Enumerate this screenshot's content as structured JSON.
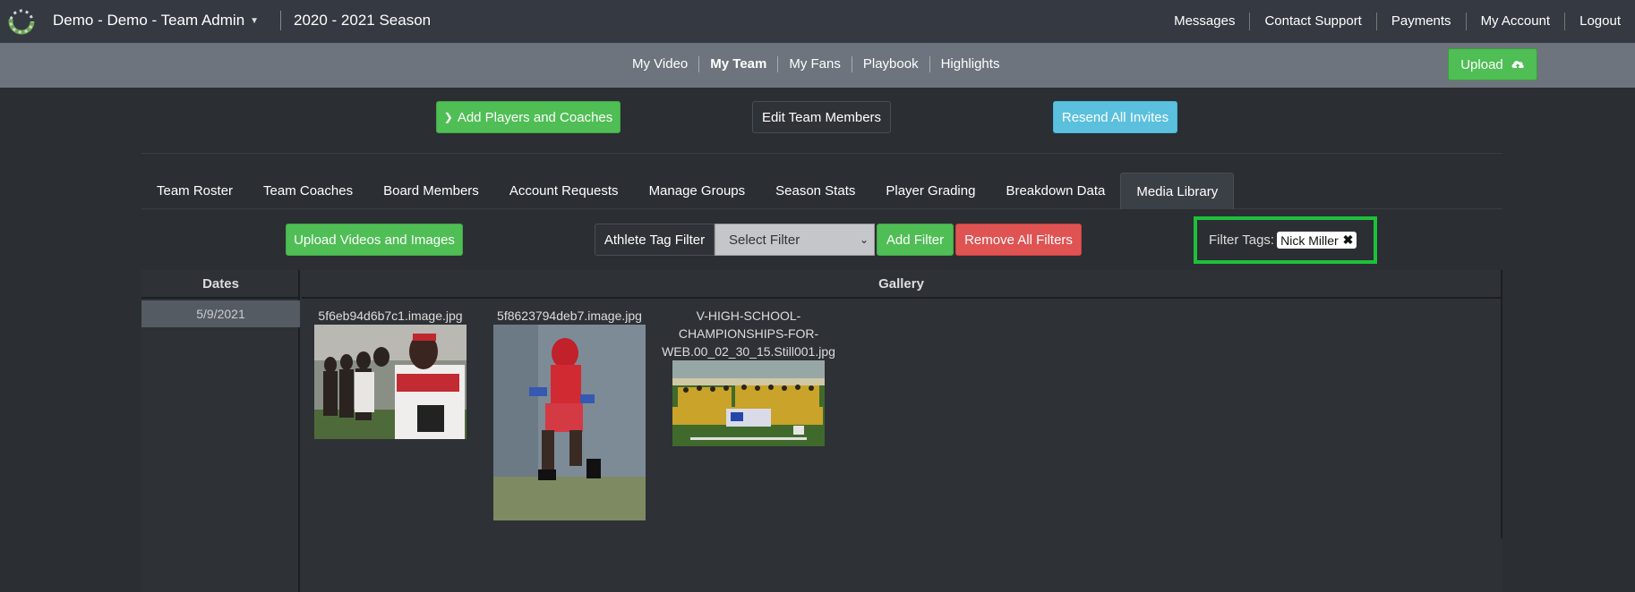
{
  "topbar": {
    "team_name": "Demo - Demo - Team Admin",
    "season": "2020 - 2021 Season",
    "links": [
      "Messages",
      "Contact Support",
      "Payments",
      "My Account",
      "Logout"
    ]
  },
  "subnav": {
    "links": [
      "My Video",
      "My Team",
      "My Fans",
      "Playbook",
      "Highlights"
    ],
    "active": "My Team",
    "upload_label": "Upload"
  },
  "actions": {
    "add_players": "Add Players and Coaches",
    "edit_members": "Edit Team Members",
    "resend_invites": "Resend All Invites"
  },
  "tabs": [
    "Team Roster",
    "Team Coaches",
    "Board Members",
    "Account Requests",
    "Manage Groups",
    "Season Stats",
    "Player Grading",
    "Breakdown Data",
    "Media Library"
  ],
  "active_tab": "Media Library",
  "filters": {
    "upload_media": "Upload Videos and Images",
    "athlete_tag_filter": "Athlete Tag Filter",
    "select_value": "Select Filter",
    "add_filter": "Add Filter",
    "remove_all": "Remove All Filters",
    "filter_tags_label": "Filter Tags:",
    "tags": [
      "Nick Miller"
    ]
  },
  "table": {
    "dates_header": "Dates",
    "gallery_header": "Gallery",
    "dates": [
      "5/9/2021"
    ],
    "gallery": [
      {
        "name": "5f6eb94d6b7c1.image.jpg"
      },
      {
        "name": "5f8623794deb7.image.jpg"
      },
      {
        "name": "V-HIGH-SCHOOL-CHAMPIONSHIPS-FOR-WEB.00_02_30_15.Still001.jpg",
        "lines": [
          "V-HIGH-SCHOOL-",
          "CHAMPIONSHIPS-FOR-",
          "WEB.00_02_30_15.Still001.jpg"
        ]
      }
    ]
  },
  "colors": {
    "accent_green": "#4fbe55",
    "info_blue": "#5bc0de",
    "danger_red": "#e05353",
    "highlight_box": "#1ec03b"
  }
}
